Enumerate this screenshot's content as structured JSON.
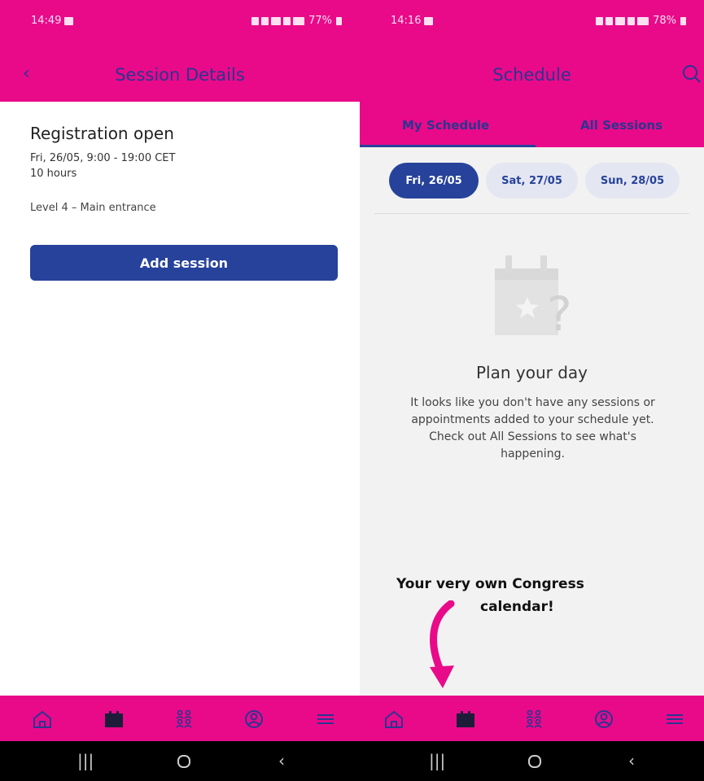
{
  "colors": {
    "accent": "#e90a8a",
    "primary": "#26429a",
    "chip_inactive": "#e4e7f1"
  },
  "left": {
    "status": {
      "time": "14:49",
      "battery": "77%"
    },
    "header": {
      "title": "Session Details",
      "back_icon": "chevron-left-icon"
    },
    "session": {
      "title": "Registration open",
      "datetime": "Fri, 26/05, 9:00 - 19:00 CET",
      "duration": "10 hours",
      "location": "Level 4 – Main entrance"
    },
    "add_button": "Add session"
  },
  "right": {
    "status": {
      "time": "14:16",
      "battery": "78%"
    },
    "header": {
      "title": "Schedule",
      "search_icon": "search-icon"
    },
    "tabs": [
      {
        "label": "My Schedule",
        "active": true
      },
      {
        "label": "All Sessions",
        "active": false
      }
    ],
    "days": [
      {
        "label": "Fri, 26/05",
        "active": true
      },
      {
        "label": "Sat, 27/05",
        "active": false
      },
      {
        "label": "Sun, 28/05",
        "active": false
      }
    ],
    "empty_state": {
      "icon": "calendar-question-icon",
      "title": "Plan your day",
      "text": "It looks like you don't have any sessions or appointments added to your schedule yet. Check out All Sessions to see what's happening."
    },
    "callout": {
      "line1": "Your very own Congress",
      "line2": "calendar!"
    }
  },
  "bottom_nav": [
    "home-icon",
    "calendar-icon",
    "people-icon",
    "profile-icon",
    "menu-icon"
  ],
  "system_nav": [
    "recent-apps-icon",
    "home-circle-icon",
    "back-icon"
  ]
}
